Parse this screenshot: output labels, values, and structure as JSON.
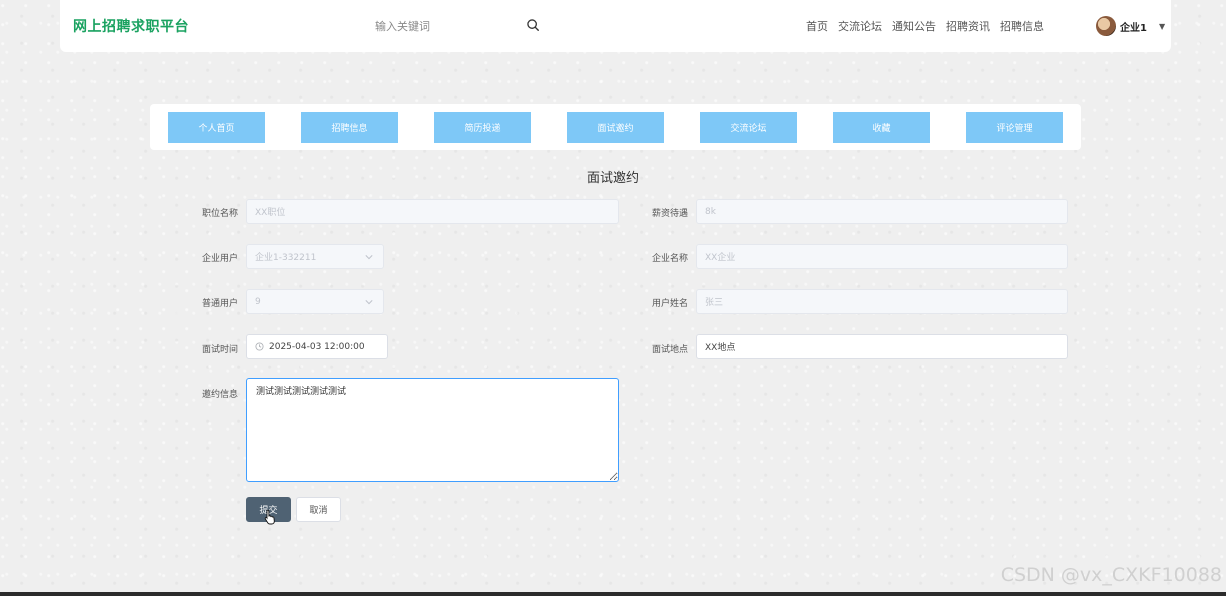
{
  "header": {
    "brand": "网上招聘求职平台",
    "search_placeholder": "输入关键词",
    "nav": [
      "首页",
      "交流论坛",
      "通知公告",
      "招聘资讯",
      "招聘信息"
    ],
    "user_name": "企业1"
  },
  "menu": [
    "个人首页",
    "招聘信息",
    "简历投递",
    "面试邀约",
    "交流论坛",
    "收藏",
    "评论管理"
  ],
  "form": {
    "title": "面试邀约",
    "position_label": "职位名称",
    "position_placeholder": "XX职位",
    "salary_label": "薪资待遇",
    "salary_placeholder": "8k",
    "company_user_label": "企业用户",
    "company_user_value": "企业1-332211",
    "company_name_label": "企业名称",
    "company_name_placeholder": "XX企业",
    "normal_user_label": "普通用户",
    "normal_user_value": "9",
    "user_name_label": "用户姓名",
    "user_name_placeholder": "张三",
    "time_label": "面试时间",
    "time_value": "2025-04-03 12:00:00",
    "place_label": "面试地点",
    "place_value": "XX地点",
    "message_label": "邀约信息",
    "message_value": "测试测试测试测试测试",
    "submit": "提交",
    "cancel": "取消"
  },
  "watermark": "CSDN @vx_CXKF10088",
  "colors": {
    "brand": "#1aa260",
    "menu_button": "#7ec8f7",
    "submit_button": "#4f6273",
    "focus_border": "#409eff"
  }
}
